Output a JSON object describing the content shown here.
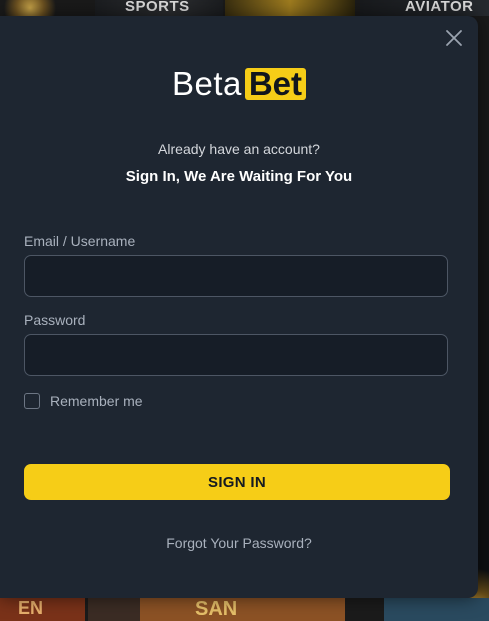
{
  "background": {
    "tiles": {
      "sports": "SPORTS",
      "aviator": "AVIATOR"
    },
    "bottom_tiles": {
      "left": "EN",
      "center": "SAN"
    }
  },
  "modal": {
    "logo": {
      "part1": "Beta",
      "part2": "Bet"
    },
    "subtitle": "Already have an account?",
    "headline": "Sign In, We Are Waiting For You",
    "email": {
      "label": "Email / Username",
      "value": "",
      "placeholder": ""
    },
    "password": {
      "label": "Password",
      "value": "",
      "placeholder": ""
    },
    "remember": {
      "label": "Remember me",
      "checked": false
    },
    "signin_button": "SIGN IN",
    "forgot_link": "Forgot Your Password?",
    "close_icon": "close-icon"
  },
  "colors": {
    "accent": "#f6cd17",
    "modal_bg": "#1e2631",
    "input_bg": "#161d27",
    "muted_text": "#a9b1bd"
  }
}
